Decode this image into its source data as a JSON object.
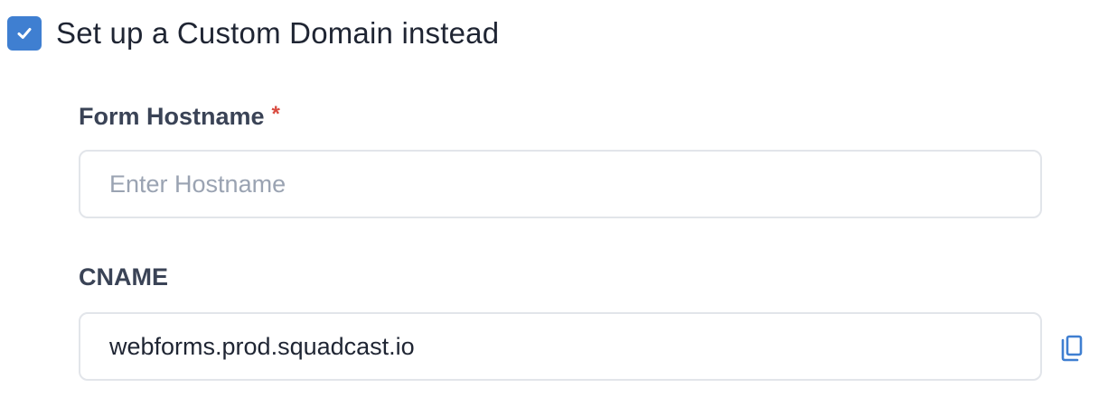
{
  "custom_domain": {
    "checkbox_checked": true,
    "checkbox_color": "#3f7fd1",
    "label": "Set up a Custom Domain instead"
  },
  "hostname_field": {
    "label": "Form Hostname",
    "required_marker": "*",
    "placeholder": "Enter Hostname",
    "value": ""
  },
  "cname_field": {
    "label": "CNAME",
    "value": "webforms.prod.squadcast.io",
    "copy_icon": "copy-icon",
    "copy_icon_color": "#3f7fd1"
  }
}
